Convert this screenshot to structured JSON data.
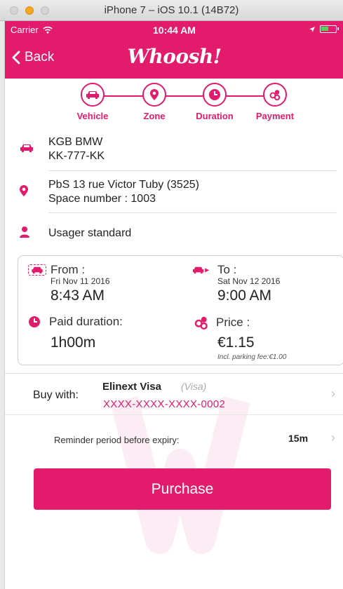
{
  "simulator": {
    "title": "iPhone 7 – iOS 10.1 (14B72)"
  },
  "status_bar": {
    "carrier": "Carrier",
    "time": "10:44 AM"
  },
  "nav": {
    "back_label": "Back",
    "logo_text": "Whoosh!"
  },
  "steps": [
    {
      "label": "Vehicle",
      "icon": "car-icon"
    },
    {
      "label": "Zone",
      "icon": "location-pin-icon"
    },
    {
      "label": "Duration",
      "icon": "clock-icon"
    },
    {
      "label": "Payment",
      "icon": "coins-icon"
    }
  ],
  "vehicle": {
    "name": "KGB BMW",
    "plate": "KK-777-KK"
  },
  "zone": {
    "address": "PbS 13 rue Victor Tuby (3525)",
    "space": "Space number : 1003"
  },
  "user": {
    "type": "Usager standard"
  },
  "session": {
    "from_label": "From :",
    "from_date": "Fri Nov 11 2016",
    "from_time": "8:43 AM",
    "to_label": "To :",
    "to_date": "Sat Nov 12 2016",
    "to_time": "9:00 AM",
    "duration_label": "Paid duration:",
    "duration_value": "1h00m",
    "price_label": "Price :",
    "price_value": "€1.15",
    "fee_note": "Incl. parking fee:€1.00"
  },
  "payment": {
    "buy_with_label": "Buy with:",
    "card_name": "Elinext Visa",
    "card_type": "(Visa)",
    "card_number": "XXXX-XXXX-XXXX-0002"
  },
  "reminder": {
    "label": "Reminder period before expiry:",
    "value": "15m"
  },
  "actions": {
    "purchase_label": "Purchase"
  },
  "colors": {
    "accent": "#e31b6d"
  }
}
